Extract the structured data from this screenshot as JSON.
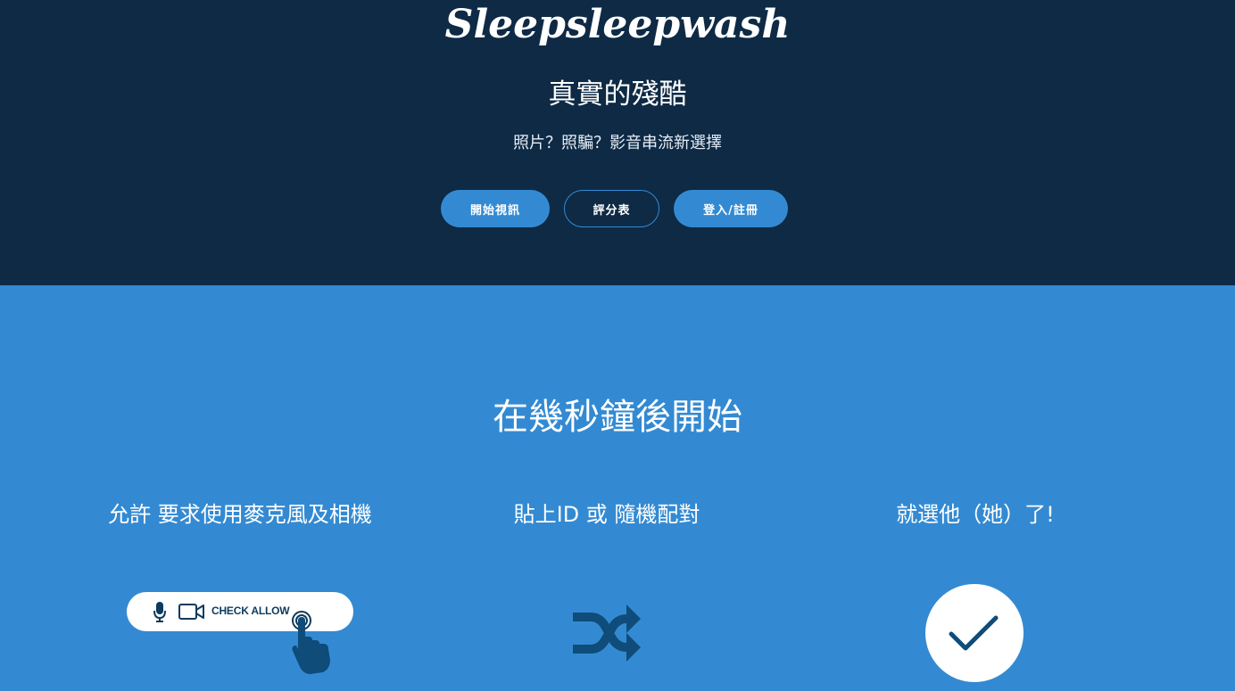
{
  "hero": {
    "logo": "Sleepsleepwash",
    "tagline": "真實的殘酷",
    "subtitle": "照片？照騙？影音串流新選擇",
    "buttons": {
      "start_video": "開始視訊",
      "rating": "評分表",
      "login_register": "登入/註冊"
    }
  },
  "steps": {
    "heading": "在幾秒鐘後開始",
    "items": [
      {
        "title": "允許 要求使用麥克風及相機",
        "icon": "allow-permission-illustration"
      },
      {
        "title": "貼上ID 或 隨機配對",
        "icon": "shuffle-icon"
      },
      {
        "title": "就選他（她）了!",
        "icon": "checkmark-icon"
      }
    ],
    "allow_label": "CHECK ALLOW"
  },
  "colors": {
    "hero_bg": "#0e2a45",
    "steps_bg": "#338ad2",
    "button_primary": "#348ad2",
    "icon_dark": "#0f4c7a"
  }
}
